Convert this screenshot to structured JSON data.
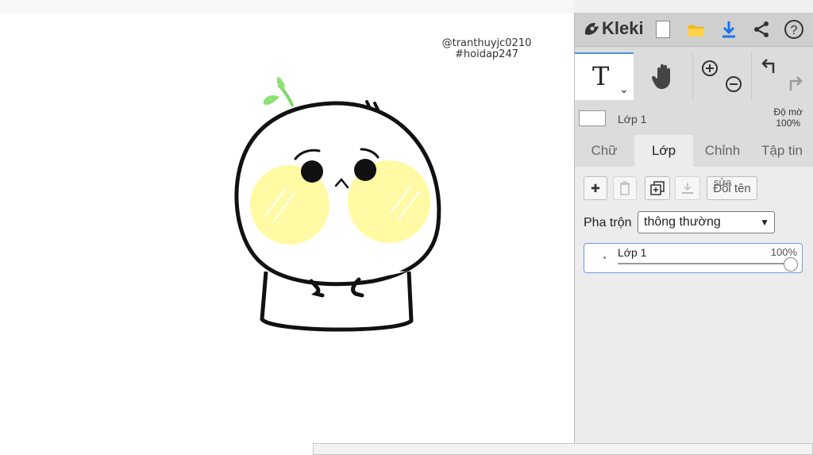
{
  "app": {
    "name": "Kleki",
    "colors": {
      "accent": "#4a90e2",
      "panel": "#dcdcdc",
      "download": "#1a73e8",
      "folder": "#f5b90a"
    }
  },
  "canvas": {
    "credit_line1": "@tranthuyjc0210",
    "credit_line2": "#hoidap247"
  },
  "topbar": {
    "logo": "Kleki",
    "icons": [
      "new-file-icon",
      "folder-icon",
      "download-icon",
      "share-icon",
      "help-icon"
    ]
  },
  "tools": {
    "text_tool_label": "T",
    "caret": "⌄",
    "icons": [
      "text-tool-icon",
      "hand-tool-icon",
      "zoom-in-icon",
      "zoom-out-icon",
      "undo-icon",
      "redo-icon"
    ]
  },
  "layer_header": {
    "name": "Lớp 1",
    "opacity_label": "Độ mờ",
    "opacity_value": "100%"
  },
  "tabs": [
    {
      "label": "Chữ",
      "active": false
    },
    {
      "label": "Lớp",
      "active": true
    },
    {
      "label": "Chỉnh",
      "active": false
    },
    {
      "label": "Tập tin",
      "active": false
    }
  ],
  "layers_panel": {
    "buttons": {
      "add": "✚",
      "rename_line1": "sửa",
      "rename_line2": "Đổi tên"
    },
    "blend_label": "Pha trộn",
    "blend_value": "thông thường",
    "layer_item": {
      "name": "Lớp 1",
      "opacity": "100%"
    }
  }
}
